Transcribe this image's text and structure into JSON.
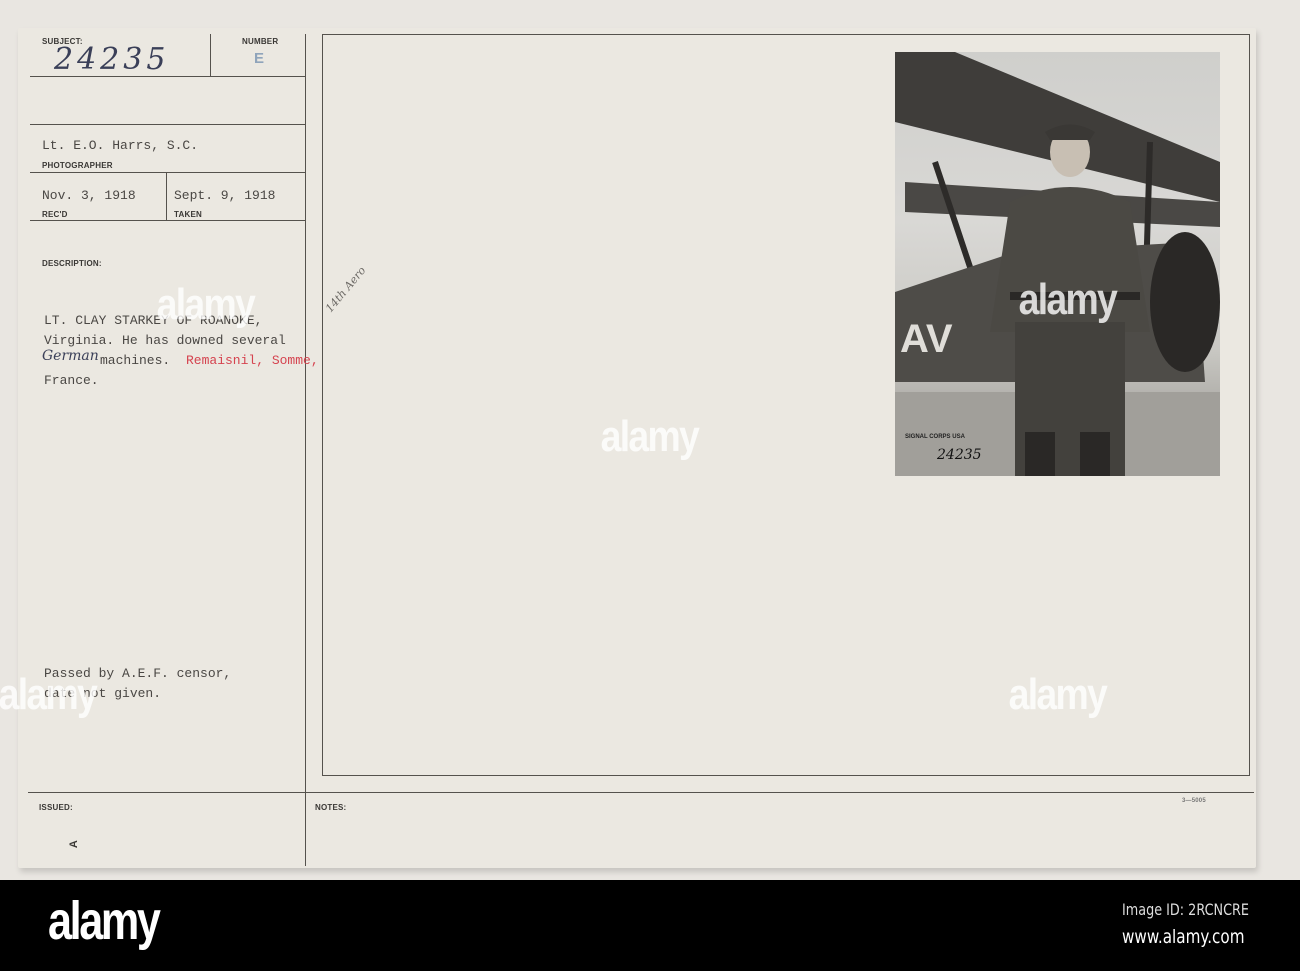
{
  "card": {
    "subject_label": "SUBJECT:",
    "subject_value": "24235",
    "number_label": "NUMBER",
    "number_value": "E",
    "photographer": "Lt. E.O. Harrs, S.C.",
    "photographer_label": "PHOTOGRAPHER",
    "received": "Nov. 3, 1918",
    "received_label": "REC'D",
    "taken": "Sept. 9, 1918",
    "taken_label": "TAKEN",
    "description_label": "DESCRIPTION:",
    "description_lines": [
      "LT. CLAY STARKEY OF ROANOKE,",
      "Virginia. He has downed several",
      "machines.",
      "France."
    ],
    "handwritten_german": "German",
    "location_red": "Remaisnil, Somme,",
    "handwritten_note": "14th Aero",
    "censor_lines": [
      "Passed by A.E.F. censor,",
      "date not given."
    ],
    "issued_label": "ISSUED:",
    "notes_label": "NOTES:",
    "form_number": "3—5005",
    "corner_mark": "A",
    "photo_stamp": "SIGNAL CORPS USA",
    "photo_number": "24235"
  },
  "watermark": "alamy",
  "footer": {
    "logo": "alamy",
    "image_id": "Image ID: 2RCNCRE",
    "url": "www.alamy.com"
  },
  "colors": {
    "paper": "#ebe8e1",
    "ink": "#4a4744",
    "red_ink": "#d5434f"
  }
}
